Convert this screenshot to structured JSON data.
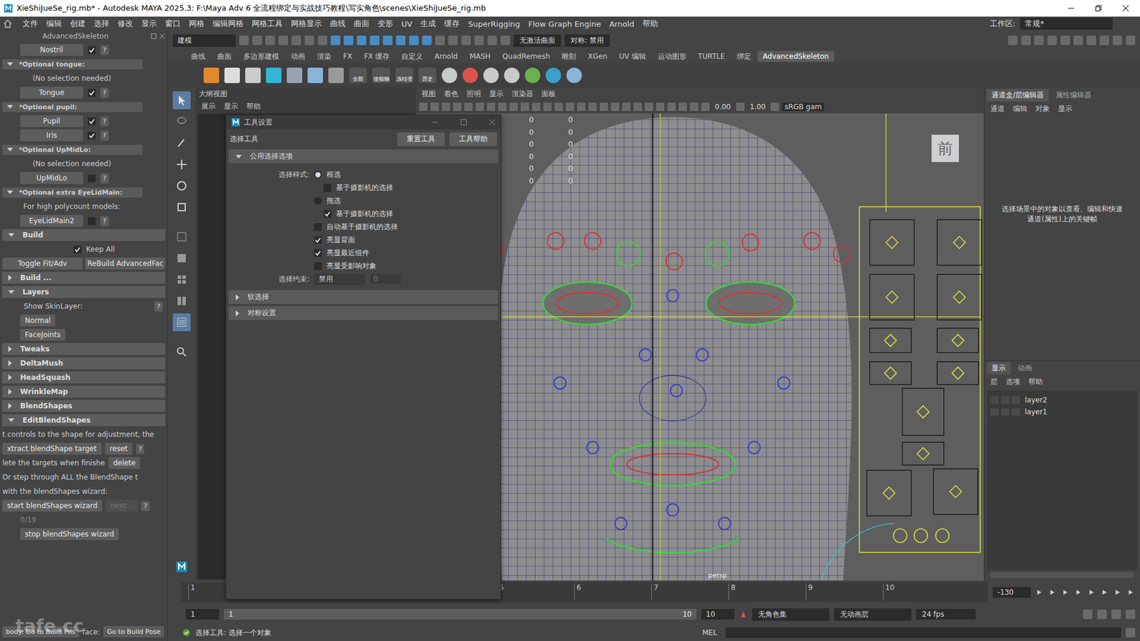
{
  "window": {
    "title": "XieShiJueSe_rig.mb* - Autodesk MAYA 2025.3: F:\\Maya Adv 6 全流程绑定与实战技巧教程\\写实角色\\scenes\\XieShiJueSe_rig.mb"
  },
  "menubar": {
    "items": [
      "文件",
      "编辑",
      "创建",
      "选择",
      "修改",
      "显示",
      "窗口",
      "网格",
      "编辑网格",
      "网格工具",
      "网格显示",
      "曲线",
      "曲面",
      "变形",
      "UV",
      "生成",
      "缓存",
      "SuperRigging",
      "Flow Graph Engine",
      "Arnold",
      "帮助"
    ],
    "workspace_label": "工作区:",
    "workspace_value": "常规*"
  },
  "statusline": {
    "mode": "建模",
    "live_surface": "无激活曲面",
    "symmetry": "对称: 禁用"
  },
  "shelf": {
    "tabs": [
      {
        "label": "曲线",
        "selected": false
      },
      {
        "label": "曲面",
        "selected": false
      },
      {
        "label": "多边形建模",
        "selected": false
      },
      {
        "label": "动画",
        "selected": false
      },
      {
        "label": "渲染",
        "selected": false
      },
      {
        "label": "FX",
        "selected": false
      },
      {
        "label": "FX 缓存",
        "selected": false
      },
      {
        "label": "自定义",
        "selected": false
      },
      {
        "label": "Arnold",
        "selected": false
      },
      {
        "label": "MASH",
        "selected": false
      },
      {
        "label": "QuadRemesh",
        "selected": false
      },
      {
        "label": "雕刻",
        "selected": false
      },
      {
        "label": "XGen",
        "selected": false
      },
      {
        "label": "UV 编辑",
        "selected": false
      },
      {
        "label": "运动图形",
        "selected": false
      },
      {
        "label": "TURTLE",
        "selected": false
      },
      {
        "label": "绑定",
        "selected": false
      },
      {
        "label": "AdvancedSkeleton",
        "selected": true
      }
    ],
    "icon_labels": [
      "全部",
      "使能轴",
      "冻结变",
      "历史"
    ]
  },
  "left_panel": {
    "title": "AdvancedSkeleton",
    "rows": [
      {
        "kind": "button",
        "label": "Nostril",
        "checked": true,
        "help": "?"
      },
      {
        "kind": "subsection",
        "label": "*Optional tongue:",
        "expanded": true
      },
      {
        "kind": "note",
        "text": "(No selection needed)"
      },
      {
        "kind": "button",
        "label": "Tongue",
        "checked": true,
        "help": "?"
      },
      {
        "kind": "subsection",
        "label": "*Optional pupil:",
        "expanded": true
      },
      {
        "kind": "button",
        "label": "Pupil",
        "checked": true,
        "help": "?"
      },
      {
        "kind": "button",
        "label": "Iris",
        "checked": true,
        "help": "?"
      },
      {
        "kind": "subsection",
        "label": "*Optional UpMidLo:",
        "expanded": true
      },
      {
        "kind": "note",
        "text": "(No selection needed)"
      },
      {
        "kind": "button",
        "label": "UpMidLo",
        "checked": false,
        "help": "?"
      },
      {
        "kind": "subsection",
        "label": "*Optional extra EyeLidMain:",
        "expanded": true
      },
      {
        "kind": "note",
        "text": "For high polycount models:"
      },
      {
        "kind": "button",
        "label": "EyeLidMain2",
        "checked": false,
        "help": "?"
      },
      {
        "kind": "section",
        "label": "Build",
        "expanded": true
      },
      {
        "kind": "check",
        "label": "Keep All",
        "checked": true
      },
      {
        "kind": "pair",
        "buttons": [
          "Toggle Fit/Adv",
          "ReBuild AdvancedFac"
        ]
      },
      {
        "kind": "section",
        "label": "Build ...",
        "expanded": false
      },
      {
        "kind": "section",
        "label": "Layers",
        "expanded": true
      },
      {
        "kind": "labelhelp",
        "text": "Show SkinLayer:",
        "help": "?"
      },
      {
        "kind": "plain",
        "label": "Normal"
      },
      {
        "kind": "plain",
        "label": "FaceJoints"
      },
      {
        "kind": "section",
        "label": "Tweaks",
        "expanded": false
      },
      {
        "kind": "section",
        "label": "DeltaMush",
        "expanded": false
      },
      {
        "kind": "section",
        "label": "HeadSquash",
        "expanded": false
      },
      {
        "kind": "section",
        "label": "WrinkleMap",
        "expanded": false
      },
      {
        "kind": "section",
        "label": "BlendShapes",
        "expanded": false
      },
      {
        "kind": "section",
        "label": "EditBlendShapes",
        "expanded": true
      },
      {
        "kind": "text",
        "text": "t controls to the shape for adjustment, the"
      },
      {
        "kind": "action",
        "label": "xtract blendShape target",
        "button": "reset",
        "help": "?"
      },
      {
        "kind": "textbutton",
        "text": "lete the targets when finishe",
        "button": "delete"
      },
      {
        "kind": "text",
        "text": "Or step through ALL the BlendShape t"
      },
      {
        "kind": "text",
        "text": "with the blendShapes wizard:"
      },
      {
        "kind": "wizard",
        "label": "start blendShapes wizard",
        "button": "next...",
        "disabled": true,
        "help": "?"
      },
      {
        "kind": "counter",
        "text": "0/19"
      },
      {
        "kind": "plain",
        "label": "stop blendShapes wizard"
      }
    ],
    "footer": [
      "body: Go to Build Pos",
      "face:",
      "Go to Build Pose"
    ],
    "watermark": "tafe.cc"
  },
  "outliner": {
    "title": "大纲视图",
    "menu": [
      "展示",
      "显示",
      "帮助"
    ]
  },
  "tool_settings": {
    "title": "工具设置",
    "tool": "选择工具",
    "buttons": [
      "重置工具",
      "工具帮助"
    ],
    "section": {
      "label": "公用选择选项",
      "expanded": true
    },
    "style_label": "选择样式:",
    "options": [
      {
        "kind": "radio",
        "label": "框选",
        "selected": true
      },
      {
        "kind": "subcheck",
        "label": "基于摄影机的选择",
        "checked": false
      },
      {
        "kind": "radio",
        "label": "拖选",
        "selected": false
      },
      {
        "kind": "subcheck",
        "label": "基于摄影机的选择",
        "checked": true
      },
      {
        "kind": "check",
        "label": "自动基于摄影机的选择",
        "checked": false
      },
      {
        "kind": "check",
        "label": "亮显背面",
        "checked": true
      },
      {
        "kind": "check",
        "label": "亮显最近组件",
        "checked": true
      },
      {
        "kind": "check",
        "label": "亮显受影响对象",
        "checked": false
      }
    ],
    "constraint": {
      "label": "选择约束:",
      "value": "禁用",
      "number": "0"
    },
    "collapsed": [
      {
        "label": "软选择",
        "expanded": false
      },
      {
        "label": "对称设置",
        "expanded": false
      }
    ]
  },
  "viewport": {
    "menu": [
      "视图",
      "着色",
      "照明",
      "显示",
      "渲染器",
      "面板"
    ],
    "exposure": "0.00",
    "gamma": "1.00",
    "color_space": "sRGB gam",
    "view_cube": "前",
    "camera": "persp",
    "readouts_left": [
      "0",
      "0",
      "0",
      "0",
      "0",
      "0"
    ],
    "readouts_right": [
      "0",
      "0",
      "0",
      "0",
      "0",
      "0"
    ]
  },
  "channel_box": {
    "tabs": [
      {
        "label": "通道盒/层编辑器",
        "selected": true
      },
      {
        "label": "属性编辑器",
        "selected": false
      }
    ],
    "menu": [
      "通道",
      "编辑",
      "对象",
      "显示"
    ],
    "message": "选择场景中的对象以查看、编辑和快速通道(属性)上的关键帧",
    "layer_tabs": [
      {
        "label": "显示",
        "selected": true
      },
      {
        "label": "动画",
        "selected": false
      }
    ],
    "layer_menu": [
      "层",
      "选项",
      "帮助"
    ],
    "layers": [
      "layer2",
      "layer1"
    ]
  },
  "timeline": {
    "ticks": [
      "1",
      "5",
      "6",
      "7",
      "8",
      "9",
      "10"
    ],
    "current": "-130"
  },
  "range": {
    "start": "1",
    "inner_start": "1",
    "inner_end": "10",
    "end": "10",
    "character_set": "无角色集",
    "anim_layer": "无动画层",
    "fps": "24 fps"
  },
  "command_line": {
    "message": "选择工具: 选择一个对象",
    "language": "MEL"
  }
}
